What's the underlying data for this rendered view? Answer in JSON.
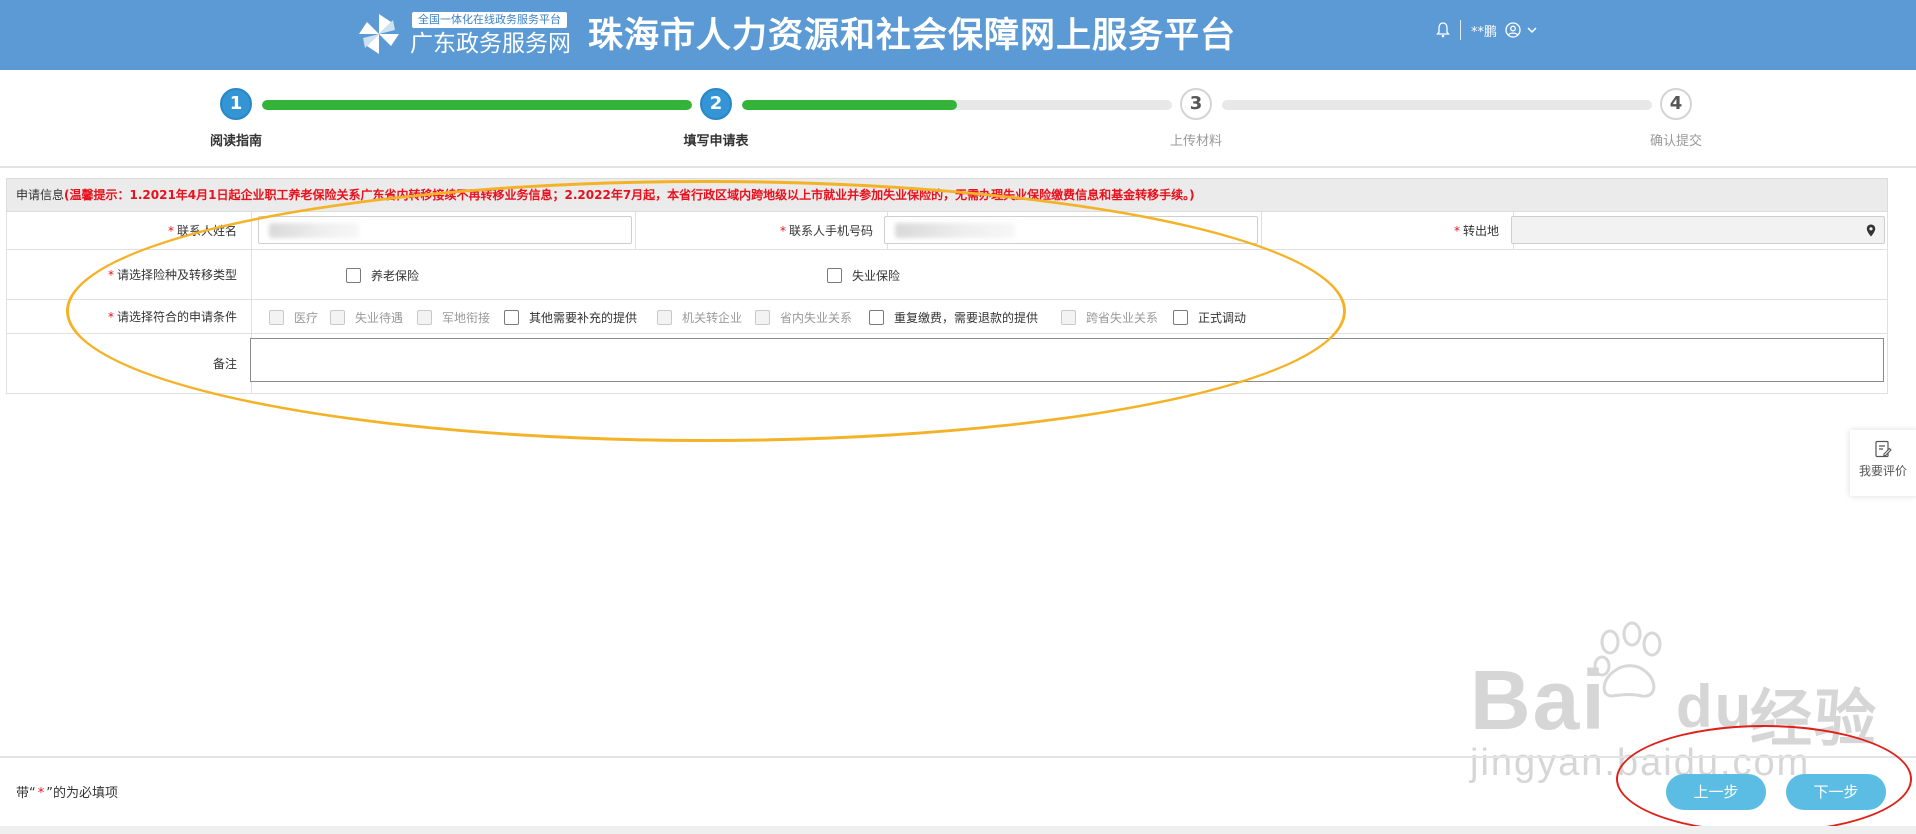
{
  "header": {
    "logo_tag": "全国一体化在线政务服务平台",
    "logo_sub": "广东政务服务网",
    "site_title": "珠海市人力资源和社会保障网上服务平台",
    "user_name": "**鹏",
    "icons": [
      "bell-icon",
      "user-icon",
      "chevron-down-icon"
    ]
  },
  "steps": [
    {
      "number": "1",
      "label": "阅读指南",
      "state": "done"
    },
    {
      "number": "2",
      "label": "填写申请表",
      "state": "done"
    },
    {
      "number": "3",
      "label": "上传材料",
      "state": "todo"
    },
    {
      "number": "4",
      "label": "确认提交",
      "state": "todo"
    }
  ],
  "progress": {
    "segment1": 1.0,
    "segment2": 0.5,
    "segment3": 0.0
  },
  "form": {
    "section_title": "申请信息",
    "notice": "(温馨提示：1.2021年4月1日起企业职工养老保险关系广东省内转移接续不再转移业务信息；2.2022年7月起，本省行政区域内跨地级以上市就业并参加失业保险的，无需办理失业保险缴费信息和基金转移手续。)",
    "required_mark": "*",
    "contact_name_label": "联系人姓名",
    "contact_phone_label": "联系人手机号码",
    "transfer_out_label": "转出地",
    "insurance_type_label": "请选择险种及转移类型",
    "insurance_options": [
      "养老保险",
      "失业保险"
    ],
    "condition_label": "请选择符合的申请条件",
    "conditions": [
      {
        "label": "医疗",
        "enabled": false
      },
      {
        "label": "失业待遇",
        "enabled": false
      },
      {
        "label": "军地衔接",
        "enabled": false
      },
      {
        "label": "其他需要补充的提供",
        "enabled": true
      },
      {
        "label": "机关转企业",
        "enabled": false
      },
      {
        "label": "省内失业关系",
        "enabled": false
      },
      {
        "label": "重复缴费，需要退款的提供",
        "enabled": true
      },
      {
        "label": "跨省失业关系",
        "enabled": false
      },
      {
        "label": "正式调动",
        "enabled": true
      }
    ],
    "remark_label": "备注"
  },
  "side": {
    "evaluate_label": "我要评价"
  },
  "watermark": {
    "brand": "Bai",
    "brand_suffix": "经验",
    "url": "jingyan.baidu.com"
  },
  "footer": {
    "note_prefix": "带“",
    "note_mark": "*",
    "note_suffix": "”的为必填项",
    "prev_label": "上一步",
    "next_label": "下一步"
  },
  "colors": {
    "header": "#5b9ad4",
    "step_done": "#3395d6",
    "progress": "#34b33a",
    "required": "#e8111c",
    "button": "#5cbde4",
    "annotation_yellow": "#f4b227",
    "annotation_red": "#e0201a"
  }
}
